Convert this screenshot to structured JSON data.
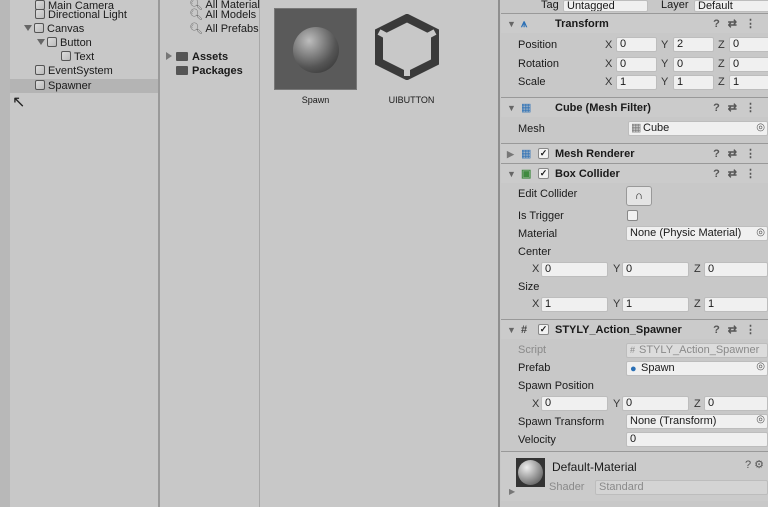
{
  "hierarchy": {
    "items": [
      "Main Camera",
      "Directional Light",
      "Canvas",
      "Button",
      "Text",
      "EventSystem",
      "Spawner"
    ]
  },
  "project": {
    "searches": [
      "All Materials",
      "All Models",
      "All Prefabs"
    ],
    "folders": [
      "Assets",
      "Packages"
    ]
  },
  "assets": [
    {
      "name": "Spawn"
    },
    {
      "name": "UIBUTTON"
    }
  ],
  "inspector": {
    "tag_label": "Tag",
    "tag_value": "Untagged",
    "layer_label": "Layer",
    "layer_value": "Default",
    "transform": {
      "title": "Transform",
      "rows": [
        {
          "label": "Position",
          "x": "0",
          "y": "2",
          "z": "0"
        },
        {
          "label": "Rotation",
          "x": "0",
          "y": "0",
          "z": "0"
        },
        {
          "label": "Scale",
          "x": "1",
          "y": "1",
          "z": "1"
        }
      ]
    },
    "mesh_filter": {
      "title": "Cube (Mesh Filter)",
      "mesh_label": "Mesh",
      "mesh_value": "Cube"
    },
    "mesh_renderer": {
      "title": "Mesh Renderer"
    },
    "box_collider": {
      "title": "Box Collider",
      "edit_label": "Edit Collider",
      "trigger_label": "Is Trigger",
      "material_label": "Material",
      "material_value": "None (Physic Material)",
      "center_label": "Center",
      "center": {
        "x": "0",
        "y": "0",
        "z": "0"
      },
      "size_label": "Size",
      "size": {
        "x": "1",
        "y": "1",
        "z": "1"
      }
    },
    "spawner": {
      "title": "STYLY_Action_Spawner",
      "script_label": "Script",
      "script_value": "STYLY_Action_Spawner",
      "prefab_label": "Prefab",
      "prefab_value": "Spawn",
      "spawn_pos_label": "Spawn Position",
      "spawn_pos": {
        "x": "0",
        "y": "0",
        "z": "0"
      },
      "spawn_transform_label": "Spawn Transform",
      "spawn_transform_value": "None (Transform)",
      "velocity_label": "Velocity",
      "velocity_value": "0"
    },
    "material": {
      "name": "Default-Material",
      "shader_label": "Shader",
      "shader_value": "Standard"
    },
    "axes": {
      "x": "X",
      "y": "Y",
      "z": "Z"
    }
  }
}
